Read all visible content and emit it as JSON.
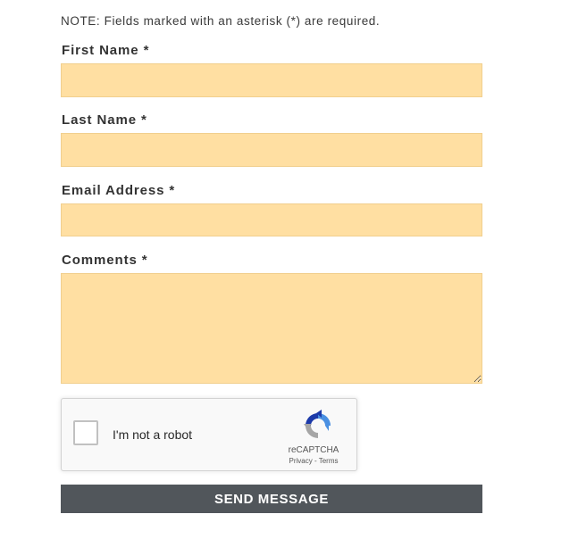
{
  "note": "NOTE: Fields marked with an asterisk (*) are required.",
  "fields": [
    {
      "label": "First Name *",
      "value": ""
    },
    {
      "label": "Last Name *",
      "value": ""
    },
    {
      "label": "Email Address *",
      "value": ""
    },
    {
      "label": "Comments *",
      "value": ""
    }
  ],
  "captcha": {
    "checkbox_label": "I'm not a robot",
    "brand": "reCAPTCHA",
    "privacy": "Privacy",
    "separator": " - ",
    "terms": "Terms",
    "checked": false
  },
  "submit_label": "SEND MESSAGE",
  "colors": {
    "input_background": "#ffdfa2",
    "button_background": "#51565b",
    "label_text": "#333333"
  }
}
